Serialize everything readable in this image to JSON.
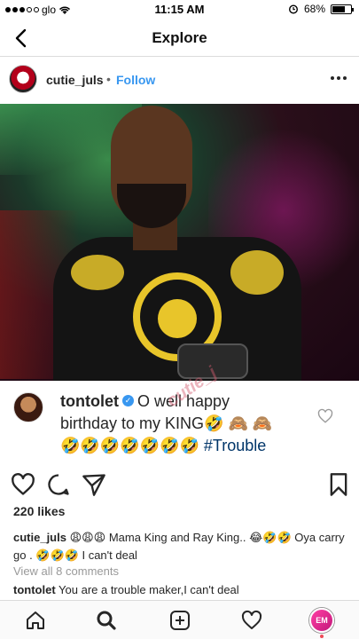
{
  "status": {
    "carrier": "glo",
    "time": "11:15 AM",
    "battery": "68%",
    "battery_level": 0.68
  },
  "nav": {
    "title": "Explore"
  },
  "post": {
    "username": "cutie_juls",
    "separator": "•",
    "follow_label": "Follow"
  },
  "comment_card": {
    "username": "tontolet",
    "line1": "O well happy",
    "line2": "birthday to my KING🤣 🙈 🙈",
    "line3_emoji": "🤣🤣🤣🤣🤣🤣🤣 ",
    "hashtag": "#Trouble",
    "watermark": "cutie_j"
  },
  "likes": "220 likes",
  "caption": {
    "username": "cutie_juls",
    "text": " 😩😩😩 Mama King and Ray King.. 😂🤣🤣 Oya carry go . 🤣🤣🤣 I can't deal"
  },
  "view_all": "View all 8 comments",
  "last_comment": {
    "username": "tontolet",
    "text": " You are a trouble maker,I can't deal"
  },
  "profile_tab_initials": "EM",
  "colors": {
    "link_blue": "#3897f0",
    "hashtag": "#003569",
    "notification": "#ed4956"
  }
}
